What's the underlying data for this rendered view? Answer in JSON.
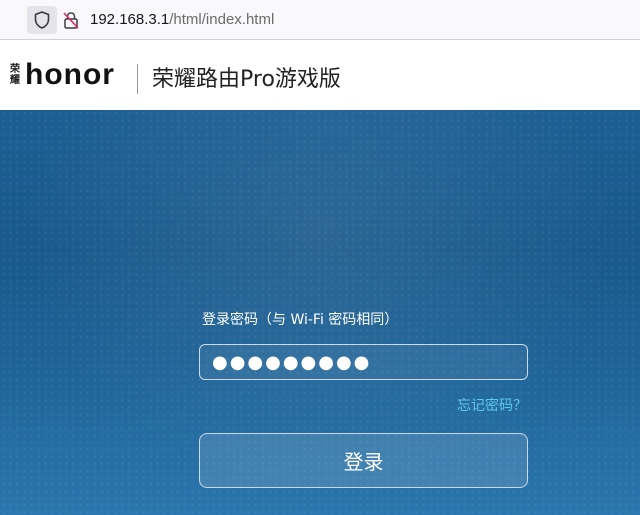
{
  "browser": {
    "url_host": "192.168.3.1",
    "url_path": "/html/index.html",
    "icons": {
      "shield": "shield-icon",
      "lock": "lock-slash-icon"
    }
  },
  "header": {
    "logo_cn": "荣耀",
    "logo_en": "honor",
    "product_name": "荣耀路由Pro游戏版"
  },
  "login": {
    "password_label": "登录密码（与 Wi-Fi 密码相同）",
    "password_value": "●●●●●●●●●",
    "forgot_link": "忘记密码？",
    "login_button": "登录"
  },
  "colors": {
    "brand_red": "#d0021b",
    "link_cyan": "#5ec9ee",
    "bg_blue": "#1d5f93"
  }
}
